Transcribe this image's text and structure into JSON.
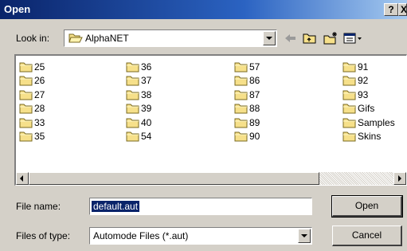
{
  "window": {
    "title": "Open",
    "help_glyph": "?",
    "close_glyph": "X"
  },
  "toolbar": {
    "look_in_label": "Look in:",
    "look_in_value": "AlphaNET",
    "icons": [
      "back-arrow-icon",
      "up-folder-icon",
      "new-folder-icon",
      "view-menu-icon"
    ]
  },
  "folders": [
    "25",
    "26",
    "27",
    "28",
    "33",
    "35",
    "36",
    "37",
    "38",
    "39",
    "40",
    "54",
    "57",
    "86",
    "87",
    "88",
    "89",
    "90",
    "91",
    "92",
    "93",
    "Gifs",
    "Samples",
    "Skins"
  ],
  "file_name": {
    "label": "File name:",
    "value": "default.aut"
  },
  "file_type": {
    "label": "Files of type:",
    "value": "Automode Files (*.aut)"
  },
  "buttons": {
    "open": "Open",
    "cancel": "Cancel"
  },
  "colors": {
    "titlebar": "#0a246a",
    "dialog": "#d4d0c8",
    "selection": "#0a246a",
    "folder": "#f6e08a"
  }
}
